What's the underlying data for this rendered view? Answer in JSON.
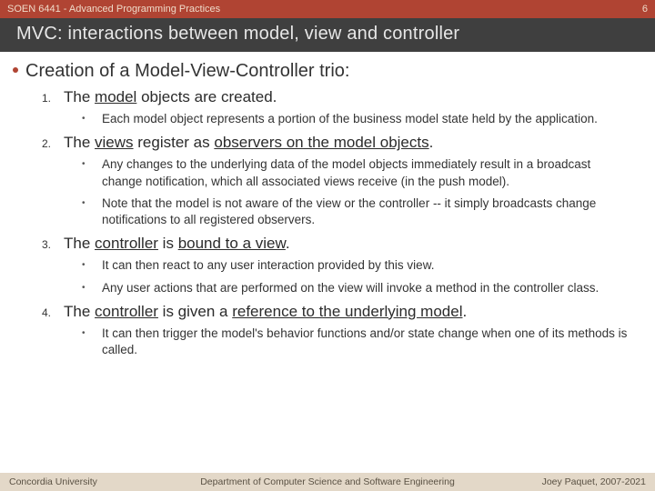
{
  "header": {
    "course": "SOEN 6441 - Advanced Programming Practices",
    "slide_number": "6",
    "title": "MVC: interactions between model, view and controller"
  },
  "heading": "Creation of a Model-View-Controller trio:",
  "steps": [
    {
      "num": "1.",
      "pre": "The ",
      "u": "model",
      "post": " objects are created.",
      "sub": [
        "Each model object represents a portion of the business model state held by the application."
      ]
    },
    {
      "num": "2.",
      "pre": "The ",
      "u": "views",
      "mid": " register as ",
      "u2": "observers on the model objects",
      "post": ".",
      "sub": [
        "Any changes to the underlying data of the model objects immediately result in a broadcast change notification, which all associated views receive (in the push model).",
        "Note that the model is not aware of the view or the controller -- it simply broadcasts change notifications to all registered observers."
      ]
    },
    {
      "num": "3.",
      "pre": "The ",
      "u": "controller",
      "mid": " is ",
      "u2": "bound to a view",
      "post": ".",
      "sub": [
        "It can then react to any user interaction provided by this view.",
        "Any user actions that are performed on the view will invoke a method in the controller class."
      ]
    },
    {
      "num": "4.",
      "pre": "The ",
      "u": "controller",
      "mid": " is given a ",
      "u2": "reference to the underlying model",
      "post": ".",
      "sub": [
        "It can then trigger the model's behavior functions and/or state change when one of its methods is called."
      ]
    }
  ],
  "footer": {
    "left": "Concordia University",
    "center": "Department of Computer Science and Software Engineering",
    "right": "Joey Paquet, 2007-2021"
  }
}
